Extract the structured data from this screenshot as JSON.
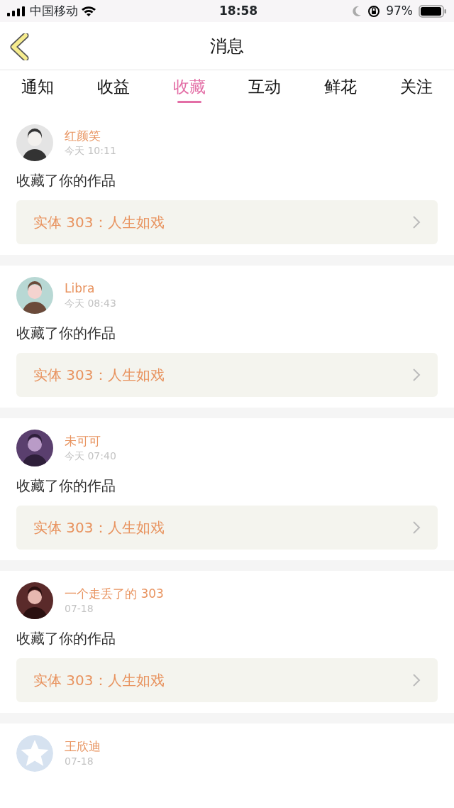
{
  "status_bar": {
    "carrier": "中国移动",
    "time": "18:58",
    "battery": "97%"
  },
  "header": {
    "title": "消息"
  },
  "tabs": [
    {
      "label": "通知",
      "selected": false
    },
    {
      "label": "收益",
      "selected": false
    },
    {
      "label": "收藏",
      "selected": true
    },
    {
      "label": "互动",
      "selected": false
    },
    {
      "label": "鲜花",
      "selected": false
    },
    {
      "label": "关注",
      "selected": false
    }
  ],
  "messages": [
    {
      "user": "红颜笑",
      "time": "今天 10:11",
      "action": "收藏了你的作品",
      "work": "实体 303：人生如戏"
    },
    {
      "user": "Libra",
      "time": "今天 08:43",
      "action": "收藏了你的作品",
      "work": "实体 303：人生如戏"
    },
    {
      "user": "未可可",
      "time": "今天 07:40",
      "action": "收藏了你的作品",
      "work": "实体 303：人生如戏"
    },
    {
      "user": "一个走丢了的 303",
      "time": "07-18",
      "action": "收藏了你的作品",
      "work": "实体 303：人生如戏"
    },
    {
      "user": "王欣迪",
      "time": "07-18",
      "avatar": {
        "kind": "default"
      }
    }
  ]
}
